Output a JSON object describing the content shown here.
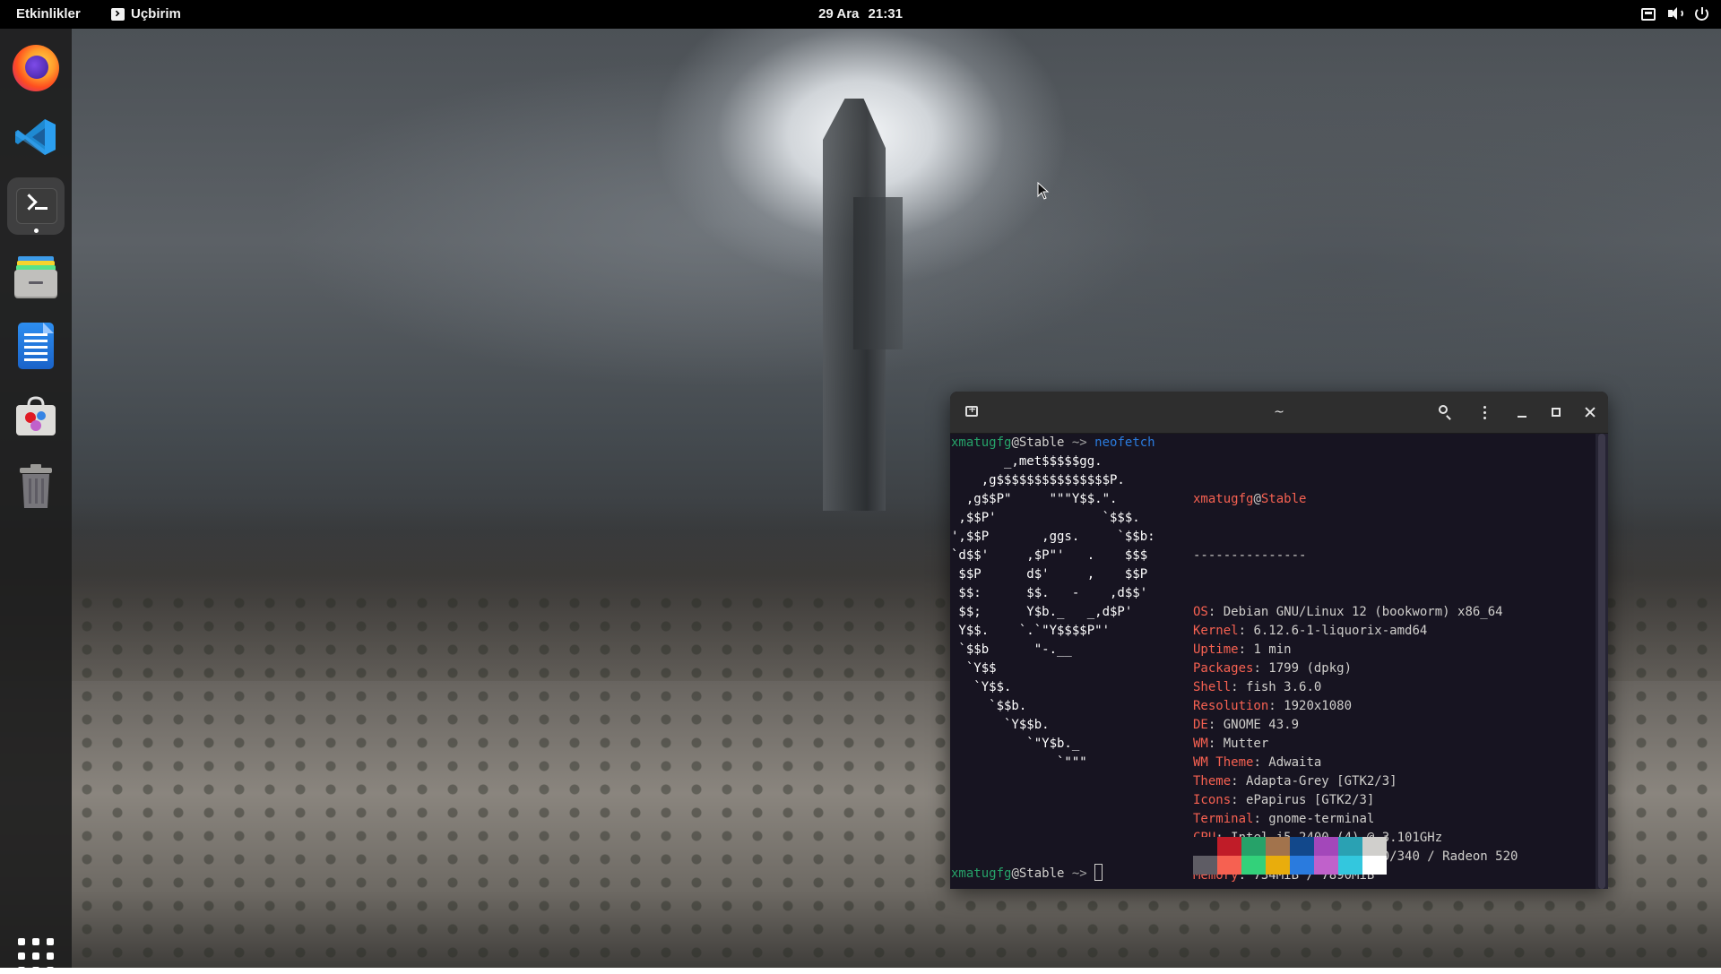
{
  "topbar": {
    "activities_label": "Etkinlikler",
    "app_menu_label": "Uçbirim",
    "clock_date": "29 Ara",
    "clock_time": "21:31",
    "tray_icons": [
      "screen-icon",
      "volume-icon",
      "power-icon"
    ]
  },
  "dock": {
    "items": [
      {
        "name": "firefox",
        "icon": "firefox-icon"
      },
      {
        "name": "vscode",
        "icon": "vscode-icon"
      },
      {
        "name": "terminal",
        "icon": "terminal-icon",
        "running": true
      },
      {
        "name": "files",
        "icon": "files-icon"
      },
      {
        "name": "libreoffice-writer",
        "icon": "writer-icon"
      },
      {
        "name": "software",
        "icon": "software-icon"
      },
      {
        "name": "trash",
        "icon": "trash-icon"
      }
    ],
    "apps_grid_icon": "apps-grid-icon"
  },
  "terminal": {
    "title": "~",
    "prompt": {
      "user": "xmatugfg",
      "at": "@",
      "host": "Stable",
      "arrow": " ~> ",
      "command": "neofetch"
    },
    "ascii_lines": [
      "       _,met$$$$$gg.",
      "    ,g$$$$$$$$$$$$$$$P.",
      "  ,g$$P\"     \"\"\"Y$$.\".",
      " ,$$P'              `$$$.",
      "',$$P       ,ggs.     `$$b:",
      "`d$$'     ,$P\"'   .    $$$",
      " $$P      d$'     ,    $$P",
      " $$:      $$.   -    ,d$$'",
      " $$;      Y$b._   _,d$P'",
      " Y$$.    `.`\"Y$$$$P\"'",
      " `$$b      \"-.__",
      "  `Y$$",
      "   `Y$$.",
      "     `$$b.",
      "       `Y$$b.",
      "          `\"Y$b._",
      "              `\"\"\""
    ],
    "info_header": {
      "user": "xmatugfg",
      "at": "@",
      "host": "Stable",
      "separator": "---------------"
    },
    "info": [
      {
        "key": "OS",
        "value": "Debian GNU/Linux 12 (bookworm) x86_64"
      },
      {
        "key": "Kernel",
        "value": "6.12.6-1-liquorix-amd64"
      },
      {
        "key": "Uptime",
        "value": "1 min"
      },
      {
        "key": "Packages",
        "value": "1799 (dpkg)"
      },
      {
        "key": "Shell",
        "value": "fish 3.6.0"
      },
      {
        "key": "Resolution",
        "value": "1920x1080"
      },
      {
        "key": "DE",
        "value": "GNOME 43.9"
      },
      {
        "key": "WM",
        "value": "Mutter"
      },
      {
        "key": "WM Theme",
        "value": "Adwaita"
      },
      {
        "key": "Theme",
        "value": "Adapta-Grey [GTK2/3]"
      },
      {
        "key": "Icons",
        "value": "ePapirus [GTK2/3]"
      },
      {
        "key": "Terminal",
        "value": "gnome-terminal"
      },
      {
        "key": "CPU",
        "value": "Intel i5-2400 (4) @ 3.101GHz"
      },
      {
        "key": "GPU",
        "value": "AMD ATI Radeon R7 240/340 / Radeon 520"
      },
      {
        "key": "Memory",
        "value": "734MiB / 7890MiB"
      }
    ],
    "palette_top": [
      "#171421",
      "#c01c28",
      "#26a269",
      "#a2734c",
      "#12488b",
      "#a347ba",
      "#2aa1b3",
      "#d0cfcc"
    ],
    "palette_bottom": [
      "#5e5c64",
      "#f66151",
      "#33d17a",
      "#e9ad0c",
      "#2a7bde",
      "#c061cb",
      "#33c7de",
      "#ffffff"
    ]
  }
}
